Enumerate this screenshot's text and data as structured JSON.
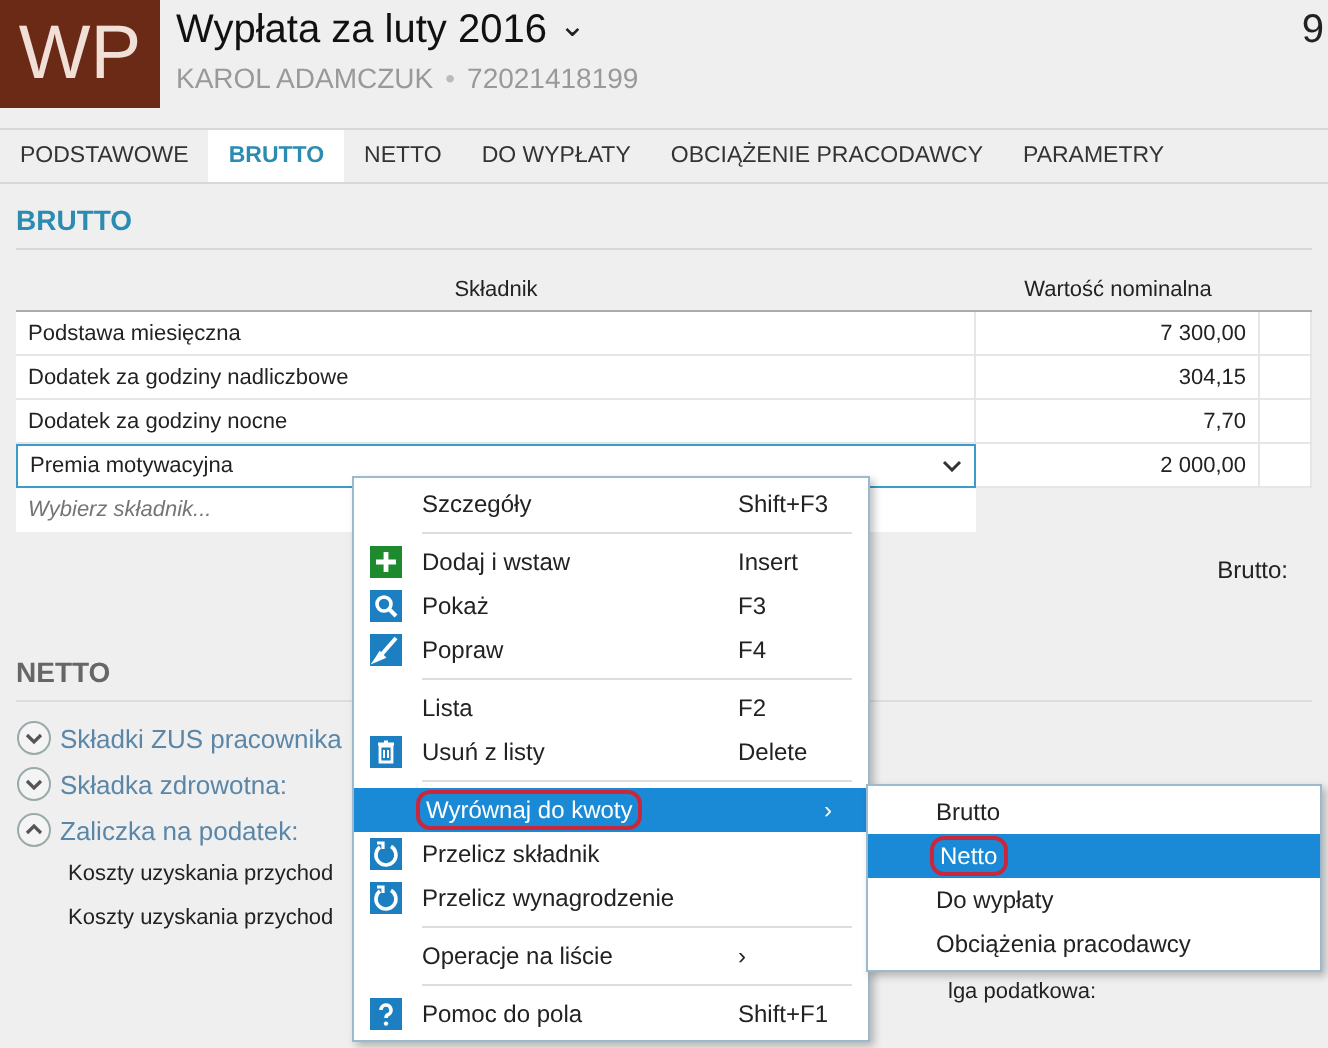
{
  "header": {
    "logo": "WP",
    "title": "Wypłata za luty 2016",
    "caret": "⌄",
    "person": "KAROL ADAMCZUK",
    "separator": "•",
    "pesel": "72021418199",
    "corner": "9"
  },
  "tabs": [
    {
      "label": "PODSTAWOWE",
      "selected": false
    },
    {
      "label": "BRUTTO",
      "selected": true
    },
    {
      "label": "NETTO",
      "selected": false
    },
    {
      "label": "DO WYPŁATY",
      "selected": false
    },
    {
      "label": "OBCIĄŻENIE PRACODAWCY",
      "selected": false
    },
    {
      "label": "PARAMETRY",
      "selected": false
    }
  ],
  "brutto": {
    "heading": "BRUTTO",
    "columns": [
      "Składnik",
      "Wartość nominalna"
    ],
    "rows": [
      {
        "name": "Podstawa miesięczna",
        "value": "7 300,00",
        "editing": false
      },
      {
        "name": "Dodatek za godziny nadliczbowe",
        "value": "304,15",
        "editing": false
      },
      {
        "name": "Dodatek za godziny nocne",
        "value": "7,70",
        "editing": false
      },
      {
        "name": "Premia motywacyjna",
        "value": "2 000,00",
        "editing": true
      }
    ],
    "placeholder": "Wybierz składnik...",
    "total_label": "Brutto:"
  },
  "netto": {
    "heading": "NETTO",
    "groups": [
      {
        "label": "Składki ZUS pracownika",
        "expanded": false
      },
      {
        "label": "Składka zdrowotna:",
        "expanded": false
      },
      {
        "label": "Zaliczka na podatek:",
        "expanded": true
      }
    ],
    "lines": [
      "Koszty uzyskania przychod",
      "Koszty uzyskania przychod"
    ],
    "right_lines": [
      "lga podatkowa:"
    ]
  },
  "context_menu": {
    "items": [
      {
        "kind": "plain",
        "label": "Szczegóły",
        "shortcut": "Shift+F3",
        "selected": false
      },
      {
        "kind": "separator"
      },
      {
        "kind": "add",
        "label": "Dodaj i wstaw",
        "shortcut": "Insert",
        "selected": false
      },
      {
        "kind": "view",
        "label": "Pokaż",
        "shortcut": "F3",
        "selected": false
      },
      {
        "kind": "edit",
        "label": "Popraw",
        "shortcut": "F4",
        "selected": false
      },
      {
        "kind": "separator"
      },
      {
        "kind": "plain",
        "label": "Lista",
        "shortcut": "F2",
        "selected": false
      },
      {
        "kind": "delete",
        "label": "Usuń z listy",
        "shortcut": "Delete",
        "selected": false
      },
      {
        "kind": "separator"
      },
      {
        "kind": "plain",
        "label": "Wyrównaj do kwoty",
        "selected": true,
        "submenu": true
      },
      {
        "kind": "recalc",
        "label": "Przelicz składnik",
        "selected": false
      },
      {
        "kind": "recalc",
        "label": "Przelicz wynagrodzenie",
        "selected": false
      },
      {
        "kind": "separator"
      },
      {
        "kind": "plain",
        "label": "Operacje na liście",
        "selected": false,
        "submenu": true
      },
      {
        "kind": "separator"
      },
      {
        "kind": "help",
        "label": "Pomoc do pola",
        "shortcut": "Shift+F1",
        "selected": false
      }
    ],
    "arrow": "›"
  },
  "submenu": {
    "items": [
      {
        "label": "Brutto",
        "selected": false
      },
      {
        "label": "Netto",
        "selected": true
      },
      {
        "label": "Do wypłaty",
        "selected": false
      },
      {
        "label": "Obciążenia pracodawcy",
        "selected": false
      }
    ]
  }
}
